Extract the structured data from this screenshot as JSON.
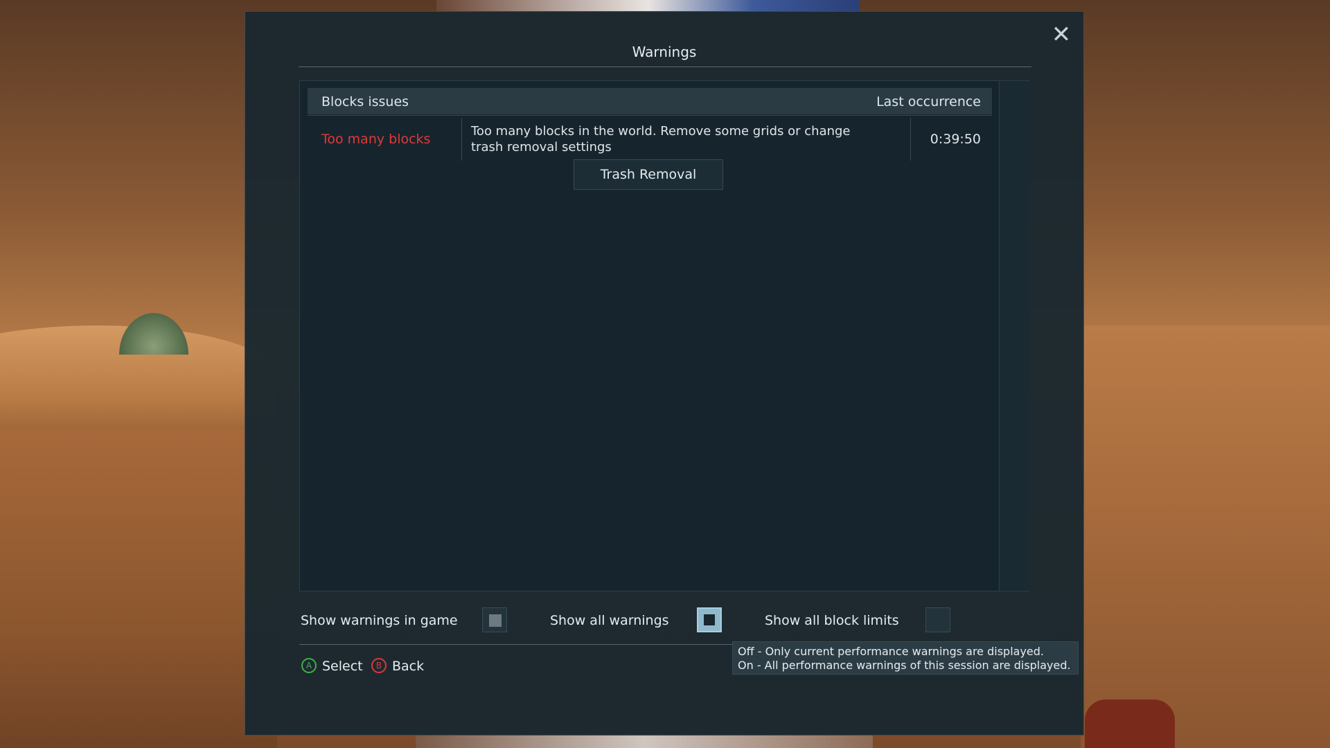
{
  "dialog": {
    "title": "Warnings",
    "close_icon": "close-icon"
  },
  "table": {
    "header_left": "Blocks issues",
    "header_right": "Last occurrence",
    "rows": [
      {
        "name": "Too many blocks",
        "description": "Too many blocks in the world. Remove some grids or change trash removal settings",
        "time": "0:39:50",
        "action_label": "Trash Removal"
      }
    ]
  },
  "options": {
    "show_in_game": {
      "label": "Show warnings in game",
      "checked": true
    },
    "show_all_warnings": {
      "label": "Show all warnings",
      "checked": true,
      "focused": true
    },
    "show_all_block_limits": {
      "label": "Show all block limits",
      "checked": false
    }
  },
  "tooltip": {
    "line1": "Off - Only current performance warnings are displayed.",
    "line2": "On - All performance warnings of this session are displayed."
  },
  "hints": {
    "select_button": "A",
    "select_label": "Select",
    "back_button": "B",
    "back_label": "Back"
  },
  "colors": {
    "warning_text": "#e03a3a",
    "focus_accent": "#8fb8cc",
    "select_icon": "#3cb24a",
    "back_icon": "#d83a3a"
  }
}
